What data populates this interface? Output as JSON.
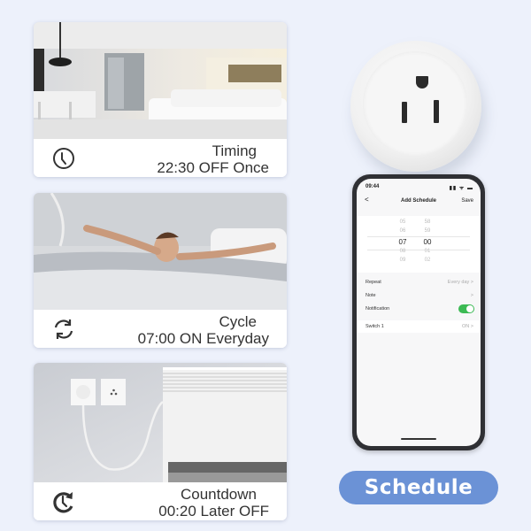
{
  "cards": [
    {
      "title": "Timing",
      "subtitle": "22:30 OFF Once",
      "icon": "clock-icon",
      "scene": "living-room"
    },
    {
      "title": "Cycle",
      "subtitle": "07:00 ON Everyday",
      "icon": "refresh-cycle-icon",
      "scene": "man-waking-in-bed"
    },
    {
      "title": "Countdown",
      "subtitle": "00:20 Later OFF",
      "icon": "countdown-clock-icon",
      "scene": "wall-outlet-with-heater"
    }
  ],
  "phone": {
    "status_time": "09:44",
    "status_icons": "signal wifi battery",
    "nav": {
      "back": "<",
      "title": "Add Schedule",
      "save": "Save"
    },
    "picker": {
      "hours": [
        "05",
        "06",
        "07",
        "08",
        "09"
      ],
      "minutes": [
        "58",
        "59",
        "00",
        "01",
        "02"
      ],
      "selected_hour": "07",
      "selected_minute": "00"
    },
    "rows": [
      {
        "label": "Repeat",
        "value": "Every day >"
      },
      {
        "label": "Note",
        "value": ">"
      },
      {
        "label": "Notification",
        "toggle": true
      },
      {
        "label": "Switch 1",
        "value": "ON >"
      }
    ]
  },
  "badge": {
    "label": "Schedule"
  },
  "colors": {
    "background": "#edf1fb",
    "badge": "#6b92d6",
    "toggle_on": "#3cba54"
  }
}
